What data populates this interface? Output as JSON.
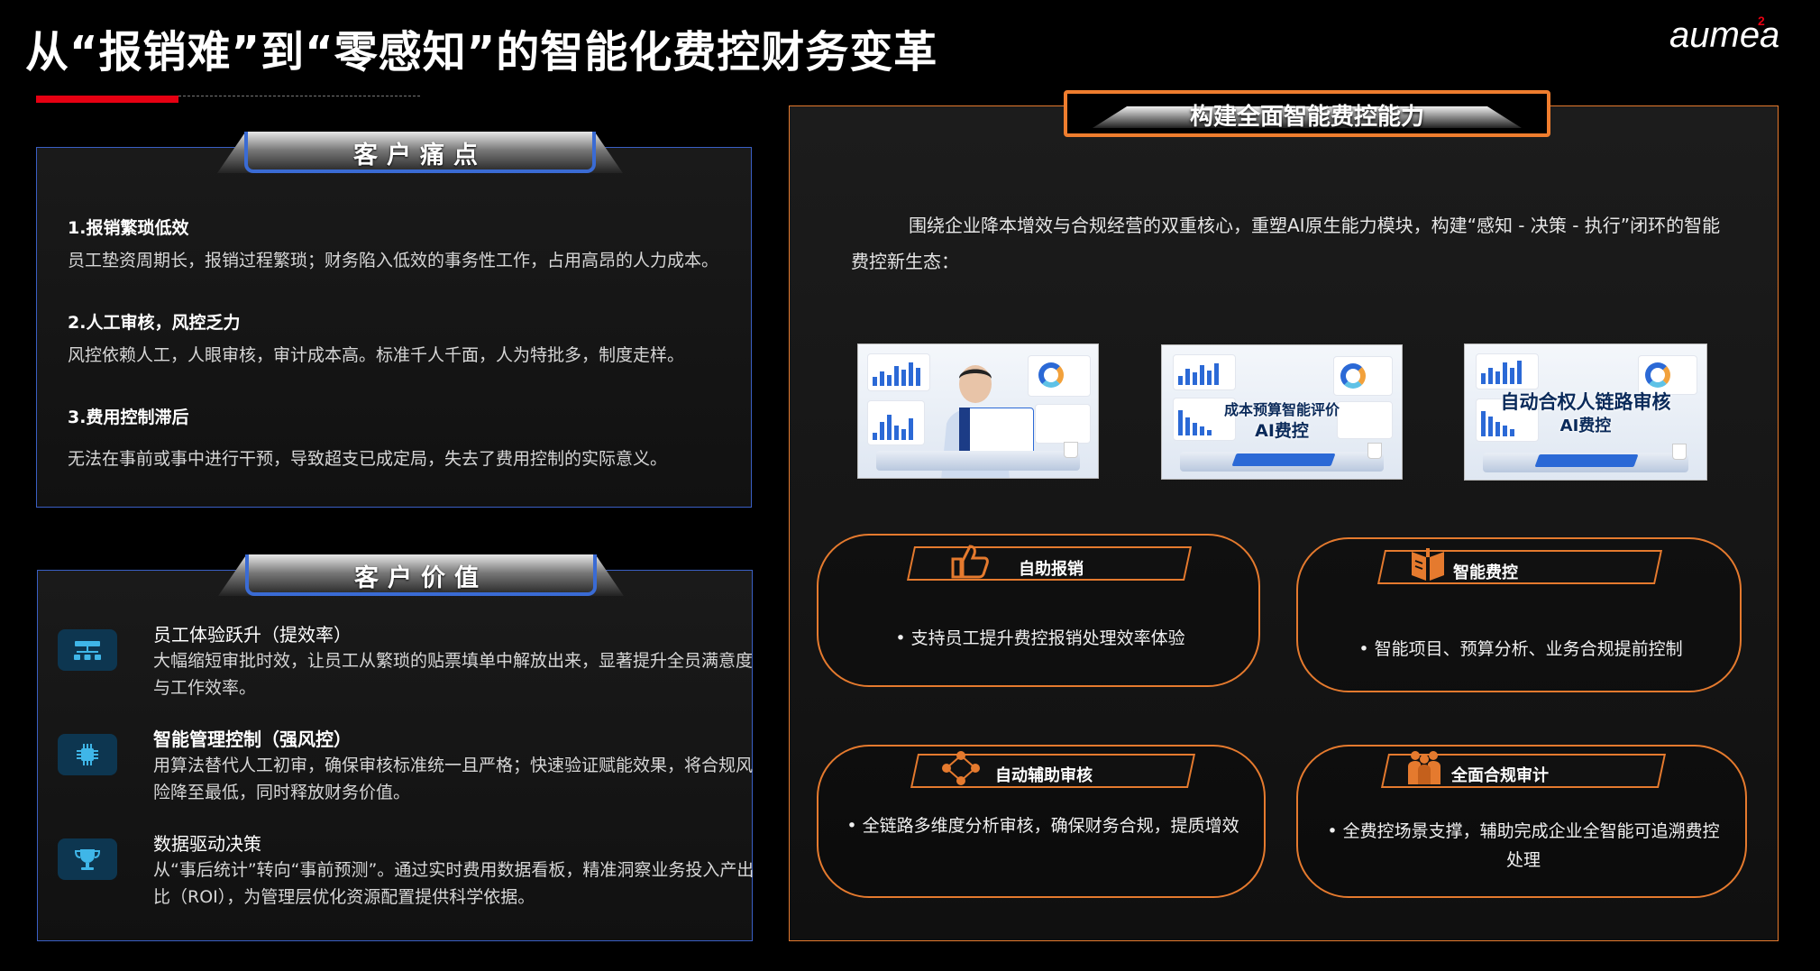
{
  "title": "从“报销难”到“零感知”的智能化费控财务变革",
  "logo": {
    "text": "aumea",
    "superscript": "2",
    "accent": "#e60012"
  },
  "colors": {
    "accent_red": "#e60012",
    "blue_frame": "#3a6bd4",
    "orange_frame": "#e57a2e",
    "background": "#000000"
  },
  "pain_points": {
    "header": "客户痛点",
    "items": [
      {
        "title": "1.报销繁琐低效",
        "desc": "员工垫资周期长，报销过程繁琐；财务陷入低效的事务性工作，占用高昂的人力成本。"
      },
      {
        "title": "2.人工审核，风控乏力",
        "desc": "风控依赖人工，人眼审核，审计成本高。标准千人千面，人为特批多，制度走样。"
      },
      {
        "title": "3.费用控制滞后",
        "desc": "无法在事前或事中进行干预，导致超支已成定局，失去了费用控制的实际意义。"
      }
    ]
  },
  "customer_value": {
    "header": "客户价值",
    "items": [
      {
        "icon": "hierarchy-icon",
        "title": "员工体验跃升（提效率）",
        "desc": "大幅缩短审批时效，让员工从繁琐的贴票填单中解放出来，显著提升全员满意度与工作效率。"
      },
      {
        "icon": "chip-icon",
        "title": "智能管理控制（强风控）",
        "desc": "用算法替代人工初审，确保审核标准统一且严格；快速验证赋能效果，将合规风险降至最低，同时释放财务价值。"
      },
      {
        "icon": "trophy-icon",
        "title": "数据驱动决策",
        "desc": "从“事后统计”转向“事前预测”。通过实时费用数据看板，精准洞察业务投入产出比（ROI），为管理层优化资源配置提供科学依据。"
      }
    ]
  },
  "capability": {
    "header": "构建全面智能费控能力",
    "intro": "围绕企业降本增效与合规经营的双重核心，重塑AI原生能力模块，构建“感知 - 决策 - 执行”闭环的智能费控新生态：",
    "images": [
      {
        "caption_line1": "",
        "caption_line2": ""
      },
      {
        "caption_line1": "成本预算智能评价",
        "caption_line2": "AI费控"
      },
      {
        "caption_line1": "自动合权人链路审核",
        "caption_line2": "AI费控"
      }
    ],
    "features": [
      {
        "icon": "thumbs-up-icon",
        "label": "自助报销",
        "text": "• 支持员工提升费控报销处理效率体验"
      },
      {
        "icon": "book-icon",
        "label": "智能费控",
        "text": "• 智能项目、预算分析、业务合规提前控制"
      },
      {
        "icon": "network-icon",
        "label": "自动辅助审核",
        "text": "• 全链路多维度分析审核，确保财务合规，提质增效"
      },
      {
        "icon": "people-icon",
        "label": "全面合规审计",
        "text": "• 全费控场景支撑，辅助完成企业全智能可追溯费控处理"
      }
    ]
  }
}
